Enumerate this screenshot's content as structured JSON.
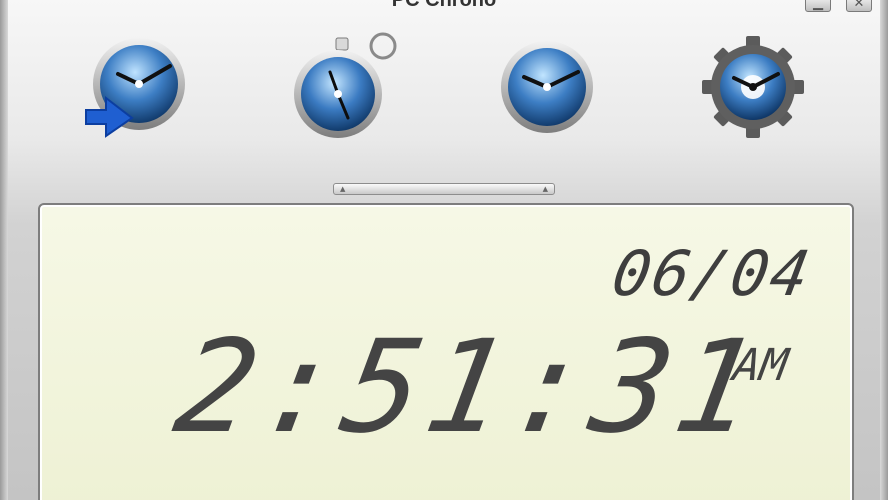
{
  "window": {
    "title": "PC Chrono",
    "minimize_glyph": "▁",
    "close_glyph": "✕"
  },
  "toolbar": {
    "buttons": [
      {
        "name": "clock-arrow-icon"
      },
      {
        "name": "stopwatch-icon"
      },
      {
        "name": "clock-icon"
      },
      {
        "name": "settings-gear-clock-icon"
      }
    ]
  },
  "grip": {
    "left_glyph": "▲",
    "right_glyph": "▲"
  },
  "display": {
    "date": "06/04",
    "time": "2:51:31",
    "ampm": "AM"
  },
  "colors": {
    "clock_blue": "#2f6fb3",
    "arrow_blue": "#1f5fd1",
    "lcd_bg": "#f2f5dd",
    "lcd_digits": "#444444"
  }
}
